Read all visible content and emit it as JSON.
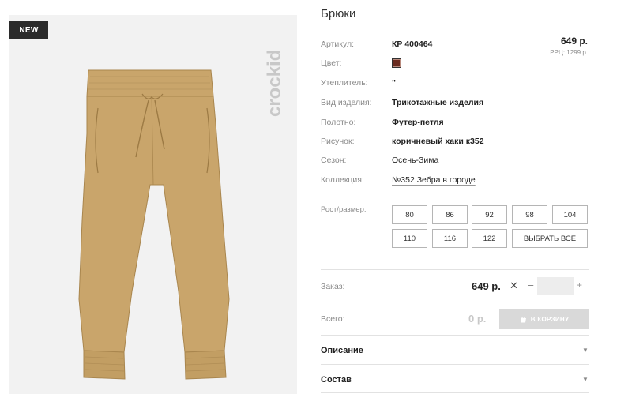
{
  "product": {
    "title": "Брюки",
    "badge": "NEW",
    "brand": "crockid"
  },
  "attributes": [
    {
      "label": "Артикул:",
      "value": "КР 400464"
    },
    {
      "label": "Цвет:",
      "value": ""
    },
    {
      "label": "Утеплитель:",
      "value": "\""
    },
    {
      "label": "Вид изделия:",
      "value": "Трикотажные изделия"
    },
    {
      "label": "Полотно:",
      "value": "Футер-петля"
    },
    {
      "label": "Рисунок:",
      "value": "коричневый хаки к352"
    },
    {
      "label": "Сезон:",
      "value": "Осень-Зима"
    },
    {
      "label": "Коллекция:",
      "value": "№352 Зебра в городе"
    }
  ],
  "color_swatch": "#6b2c20",
  "price": {
    "main": "649 р.",
    "rrp": "РРЦ: 1299 р."
  },
  "sizes": {
    "label": "Рост/размер:",
    "options": [
      "80",
      "86",
      "92",
      "98",
      "104",
      "110",
      "116",
      "122"
    ],
    "select_all": "ВЫБРАТЬ ВСЕ"
  },
  "order": {
    "label": "Заказ:",
    "price": "649 р.",
    "multiply": "✕",
    "minus": "–",
    "plus": "+",
    "quantity": ""
  },
  "total": {
    "label": "Всего:",
    "value": "0 р.",
    "cart_button": "В КОРЗИНУ",
    "cart_icon": "basket-icon"
  },
  "accordions": [
    {
      "label": "Описание",
      "icon": "chevron-down-icon"
    },
    {
      "label": "Состав",
      "icon": "chevron-down-icon"
    }
  ],
  "colors": {
    "product": "#c9a56b",
    "badge_bg": "#2b2b2b",
    "cart_button": "#d9d9d9"
  }
}
